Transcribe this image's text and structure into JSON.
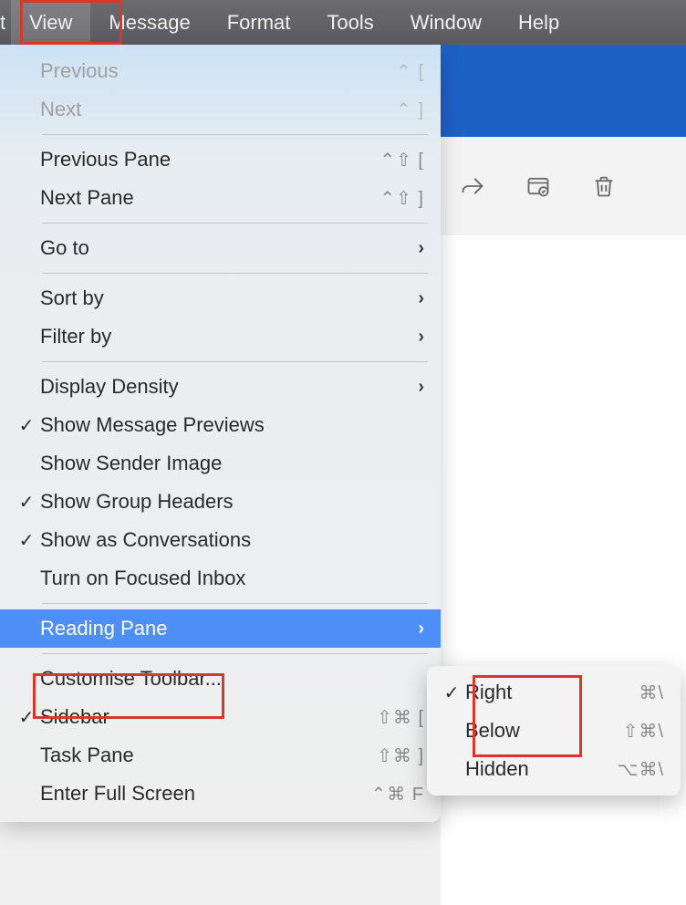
{
  "menubar": {
    "items": [
      {
        "label": "t"
      },
      {
        "label": "View",
        "active": true
      },
      {
        "label": "Message"
      },
      {
        "label": "Format"
      },
      {
        "label": "Tools"
      },
      {
        "label": "Window"
      },
      {
        "label": "Help"
      }
    ]
  },
  "viewMenu": {
    "items": [
      {
        "label": "Previous",
        "shortcut": "⌃ [",
        "disabled": true
      },
      {
        "label": "Next",
        "shortcut": "⌃ ]",
        "disabled": true
      },
      {
        "type": "divider"
      },
      {
        "label": "Previous Pane",
        "shortcut": "⌃⇧ ["
      },
      {
        "label": "Next Pane",
        "shortcut": "⌃⇧ ]"
      },
      {
        "type": "divider"
      },
      {
        "label": "Go to",
        "hasSubmenu": true
      },
      {
        "type": "divider"
      },
      {
        "label": "Sort by",
        "hasSubmenu": true
      },
      {
        "label": "Filter by",
        "hasSubmenu": true
      },
      {
        "type": "divider"
      },
      {
        "label": "Display Density",
        "hasSubmenu": true
      },
      {
        "label": "Show Message Previews",
        "checked": true
      },
      {
        "label": "Show Sender Image"
      },
      {
        "label": "Show Group Headers",
        "checked": true
      },
      {
        "label": "Show as Conversations",
        "checked": true
      },
      {
        "label": "Turn on Focused Inbox"
      },
      {
        "type": "divider"
      },
      {
        "label": "Reading Pane",
        "hasSubmenu": true,
        "selected": true
      },
      {
        "type": "divider"
      },
      {
        "label": "Customise Toolbar..."
      },
      {
        "label": "Sidebar",
        "checked": true,
        "shortcut": "⇧⌘ ["
      },
      {
        "label": "Task Pane",
        "shortcut": "⇧⌘ ]"
      },
      {
        "label": "Enter Full Screen",
        "shortcut": "⌃⌘ F"
      }
    ]
  },
  "readingPaneSubmenu": {
    "items": [
      {
        "label": "Right",
        "checked": true,
        "shortcut": "⌘\\"
      },
      {
        "label": "Below",
        "shortcut": "⇧⌘\\"
      },
      {
        "label": "Hidden",
        "shortcut": "⌥⌘\\"
      }
    ]
  },
  "highlightColor": "#d9362e"
}
